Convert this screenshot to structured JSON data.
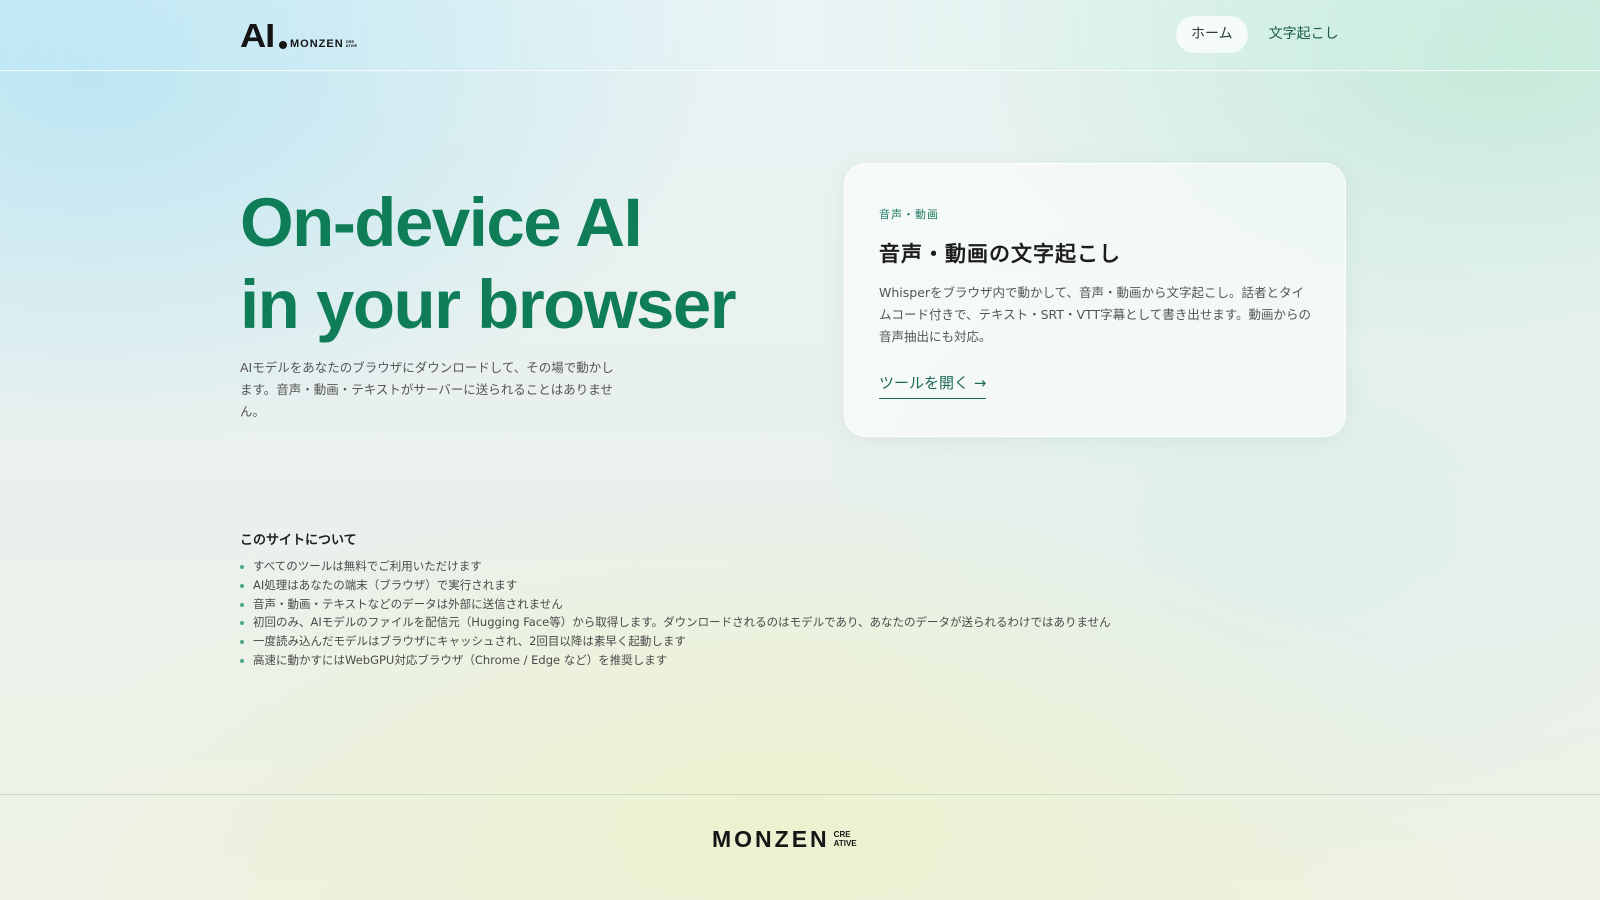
{
  "header": {
    "logo": {
      "mark": "AI",
      "wordmark": "MONZEN",
      "tiny": "CRE\nATIVE"
    },
    "nav": [
      {
        "label": "ホーム",
        "active": true
      },
      {
        "label": "文字起こし",
        "active": false
      }
    ]
  },
  "hero": {
    "title_line1": "On-device AI",
    "title_line2": "in your browser",
    "description": "AIモデルをあなたのブラウザにダウンロードして、その場で動かします。音声・動画・テキストがサーバーに送られることはありません。"
  },
  "card": {
    "category": "音声・動画",
    "title": "音声・動画の文字起こし",
    "description": "Whisperをブラウザ内で動かして、音声・動画から文字起こし。話者とタイムコード付きで、テキスト・SRT・VTT字幕として書き出せます。動画からの音声抽出にも対応。",
    "link_label": "ツールを開く →"
  },
  "about": {
    "title": "このサイトについて",
    "items": [
      "すべてのツールは無料でご利用いただけます",
      "AI処理はあなたの端末（ブラウザ）で実行されます",
      "音声・動画・テキストなどのデータは外部に送信されません",
      "初回のみ、AIモデルのファイルを配信元（Hugging Face等）から取得します。ダウンロードされるのはモデルであり、あなたのデータが送られるわけではありません",
      "一度読み込んだモデルはブラウザにキャッシュされ、2回目以降は素早く起動します",
      "高速に動かすにはWebGPU対応ブラウザ（Chrome / Edge など）を推奨します"
    ]
  },
  "footer": {
    "wordmark": "MONZEN",
    "creative": "CRE\nATIVE"
  },
  "colors": {
    "accent": "#0f7d58",
    "link": "#1e6a58",
    "bullet": "#4aa889"
  }
}
